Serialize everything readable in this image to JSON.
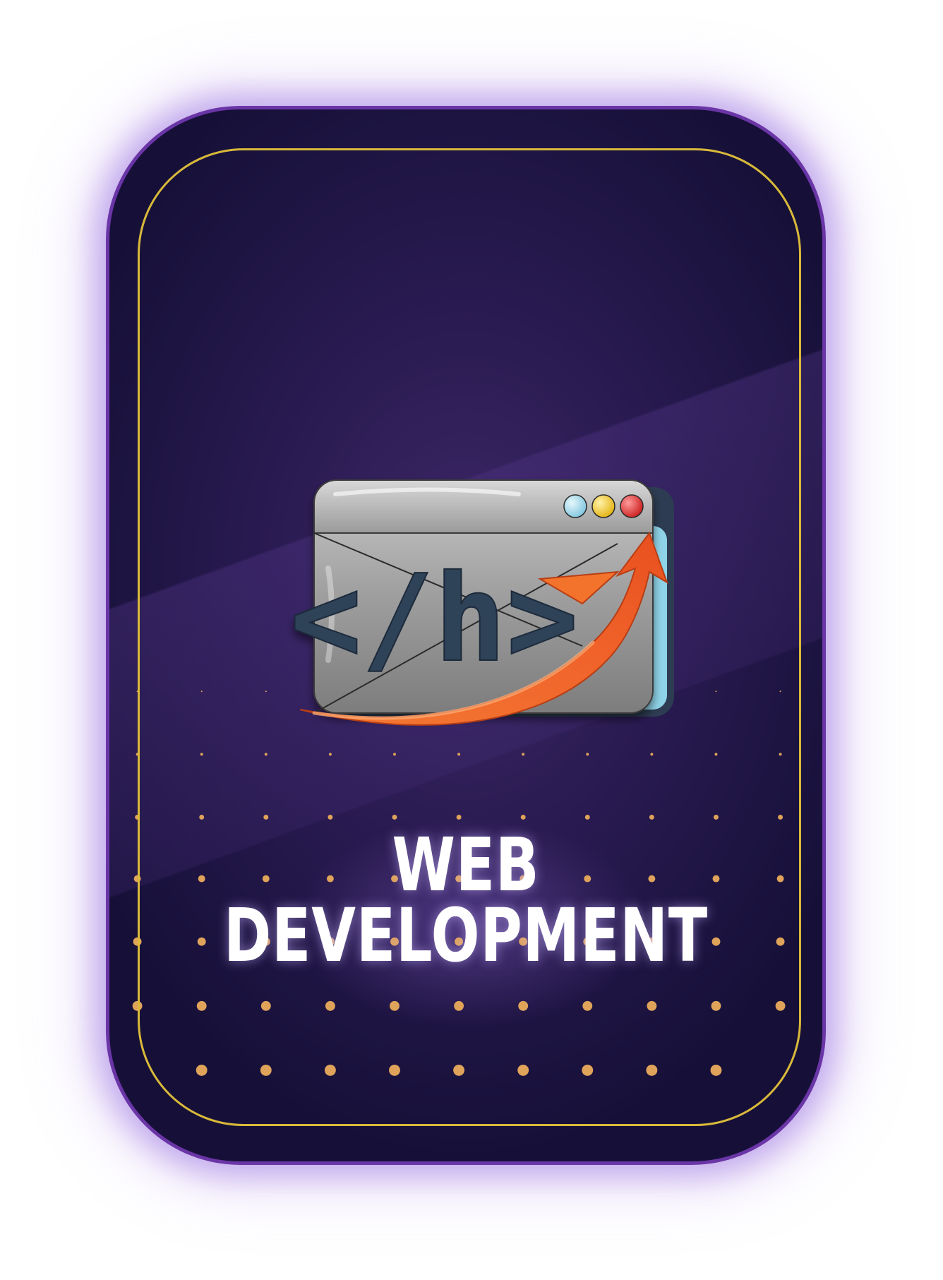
{
  "card": {
    "title_line1": "WEB",
    "title_line2": "DEVELOPMENT"
  },
  "icon": {
    "name": "code-window-icon",
    "code_text": "</h>"
  },
  "colors": {
    "card_background": "#2a1b52",
    "outer_border": "#6a35a6",
    "inner_border": "#d9b93a",
    "dots": "#e0a35a",
    "window_gray": "#9a9a9a",
    "code_text": "#2f4258",
    "arrow_orange": "#f06a2a",
    "window_accent": "#8fd3e8",
    "dot_blue": "#9fd8ea",
    "dot_yellow": "#f2c629",
    "dot_red": "#e53535",
    "title_text": "#ffffff"
  }
}
